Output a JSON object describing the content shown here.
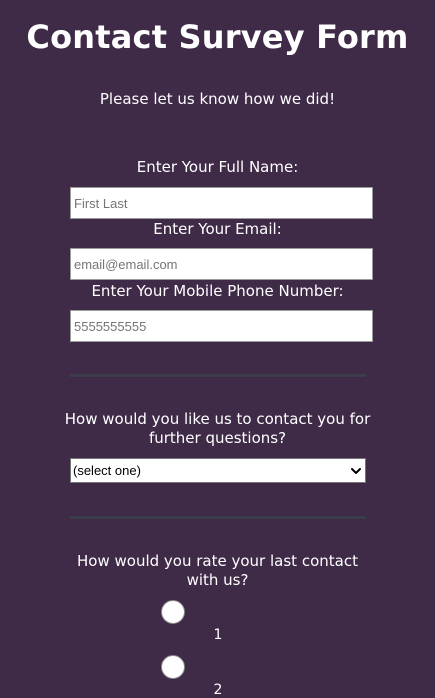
{
  "form": {
    "title": "Contact Survey Form",
    "subtitle": "Please let us know how we did!"
  },
  "fields": {
    "name": {
      "label": "Enter Your Full Name:",
      "placeholder": "First Last",
      "value": ""
    },
    "email": {
      "label": "Enter Your Email:",
      "placeholder": "email@email.com",
      "value": ""
    },
    "phone": {
      "label": "Enter Your Mobile Phone Number:",
      "placeholder": "5555555555",
      "value": ""
    }
  },
  "contact_method": {
    "question": "How would you like us to contact you for further questions?",
    "selected": "(select one)"
  },
  "rating": {
    "question": "How would you rate your last contact with us?",
    "options": [
      "1",
      "2"
    ]
  },
  "colors": {
    "background": "#3f2a48",
    "divider": "#3b3d4b",
    "text": "#ffffff"
  },
  "icons": {
    "dropdown": "chevron-down-icon"
  }
}
